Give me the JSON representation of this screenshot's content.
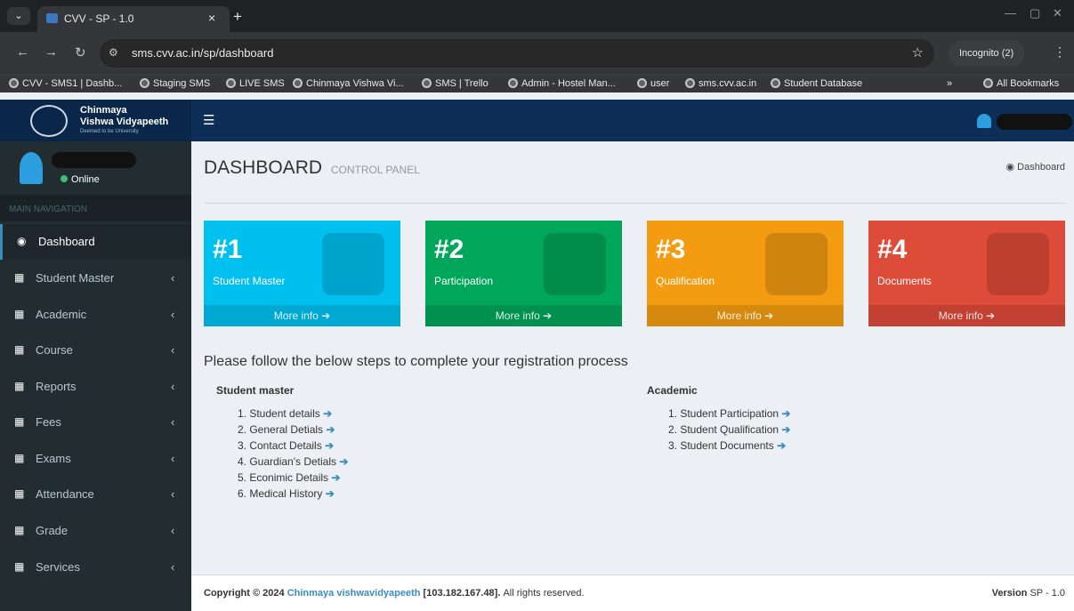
{
  "browser": {
    "tab_title": "CVV - SP - 1.0",
    "url": "sms.cvv.ac.in/sp/dashboard",
    "incognito": "Incognito (2)",
    "bookmarks": [
      "CVV - SMS1 | Dashb...",
      "Staging SMS",
      "LIVE SMS",
      "Chinmaya Vishwa Vi...",
      "SMS | Trello",
      "Admin - Hostel Man...",
      "user",
      "sms.cvv.ac.in",
      "Student Database"
    ],
    "all_bookmarks": "All Bookmarks"
  },
  "logo": {
    "line1": "Chinmaya",
    "line2": "Vishwa Vidyapeeth",
    "line3": "Deemed to be University"
  },
  "user": {
    "status": "Online"
  },
  "sidebar": {
    "nav_header": "MAIN NAVIGATION",
    "items": [
      {
        "label": "Dashboard"
      },
      {
        "label": "Student Master"
      },
      {
        "label": "Academic"
      },
      {
        "label": "Course"
      },
      {
        "label": "Reports"
      },
      {
        "label": "Fees"
      },
      {
        "label": "Exams"
      },
      {
        "label": "Attendance"
      },
      {
        "label": "Grade"
      },
      {
        "label": "Services"
      }
    ]
  },
  "page": {
    "title": "DASHBOARD",
    "subtitle": "CONTROL PANEL",
    "breadcrumb": "Dashboard"
  },
  "boxes": [
    {
      "num": "#1",
      "label": "Student Master",
      "more": "More info",
      "color": "#00c0ef"
    },
    {
      "num": "#2",
      "label": "Participation",
      "more": "More info",
      "color": "#00a65a"
    },
    {
      "num": "#3",
      "label": "Qualification",
      "more": "More info",
      "color": "#f39c12"
    },
    {
      "num": "#4",
      "label": "Documents",
      "more": "More info",
      "color": "#dd4b39"
    }
  ],
  "instructions": "Please follow the below steps to complete your registration process",
  "student_master": {
    "heading": "Student master",
    "steps": [
      "1. Student details",
      "2. General Detials",
      "3. Contact Details",
      "4. Guardian's Detials",
      "5. Econimic Details",
      "6. Medical History"
    ]
  },
  "academic": {
    "heading": "Academic",
    "steps": [
      "1. Student Participation",
      "2. Student Qualification",
      "3. Student Documents"
    ]
  },
  "footer": {
    "copyright_prefix": "Copyright © 2024",
    "org": "Chinmaya vishwavidyapeeth",
    "ip": "[103.182.167.48].",
    "rights": "All rights reserved.",
    "version_label": "Version",
    "version": "SP - 1.0"
  }
}
